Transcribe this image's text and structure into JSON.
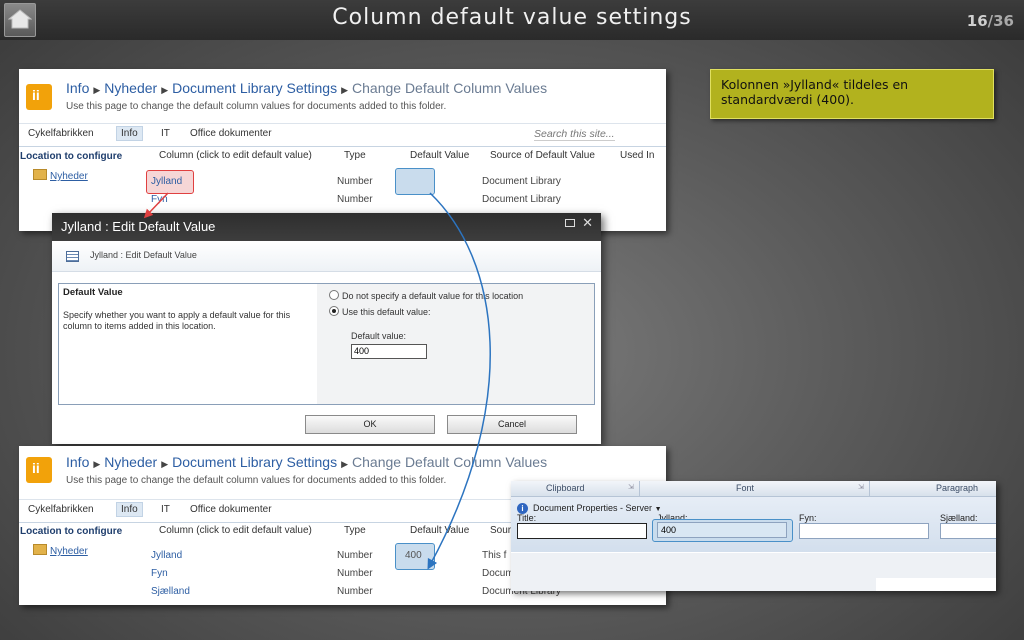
{
  "slide": {
    "title": "Column default value settings",
    "page": "16",
    "total": "/36",
    "home_icon": "home-icon"
  },
  "top_panel": {
    "breadcrumb": [
      "Info",
      "Nyheder",
      "Document Library Settings"
    ],
    "breadcrumb_last": "Change Default Column Values",
    "subtitle": "Use this page to change the default column values for documents added to this folder.",
    "nav": [
      "Cykelfabrikken",
      "Info",
      "IT",
      "Office dokumenter"
    ],
    "search_placeholder": "Search this site...",
    "headers": {
      "location": "Location to configure",
      "column": "Column (click to edit default value)",
      "type": "Type",
      "default": "Default Value",
      "source": "Source of Default Value",
      "used_in": "Used In"
    },
    "folder": "Nyheder",
    "rows": [
      {
        "column": "Jylland",
        "type": "Number",
        "default": "",
        "source": "Document Library"
      },
      {
        "column": "Fyn",
        "type": "Number",
        "default": "",
        "source": "Document Library"
      }
    ]
  },
  "dialog": {
    "title": "Jylland : Edit Default Value",
    "subtitle": "Jylland : Edit Default Value",
    "section_label": "Default Value",
    "description": "Specify whether you want to apply a default value for this column to items added in this location.",
    "option_none": "Do not specify a default value for this location",
    "option_use": "Use this default value:",
    "selected": "use",
    "value_label": "Default value:",
    "value": "400",
    "ok": "OK",
    "cancel": "Cancel"
  },
  "callout": {
    "text": "Kolonnen »Jylland« tildeles en standardværdi (400)."
  },
  "bottom_panel": {
    "breadcrumb": [
      "Info",
      "Nyheder",
      "Document Library Settings"
    ],
    "breadcrumb_last": "Change Default Column Values",
    "subtitle": "Use this page to change the default column values for documents added to this folder.",
    "nav": [
      "Cykelfabrikken",
      "Info",
      "IT",
      "Office dokumenter"
    ],
    "headers": {
      "location": "Location to configure",
      "column": "Column (click to edit default value)",
      "type": "Type",
      "default": "Default Value",
      "source": "Sour"
    },
    "folder": "Nyheder",
    "rows": [
      {
        "column": "Jylland",
        "type": "Number",
        "default": "400",
        "source": "This f"
      },
      {
        "column": "Fyn",
        "type": "Number",
        "default": "",
        "source": "Docum"
      },
      {
        "column": "Sjælland",
        "type": "Number",
        "default": "",
        "source": "Document Library"
      }
    ]
  },
  "ribbon": {
    "groups": [
      "Clipboard",
      "Font",
      "Paragraph"
    ],
    "docprops": "Document Properties - Server",
    "fields": [
      {
        "label": "Title:",
        "value": ""
      },
      {
        "label": "Jylland:",
        "value": "400"
      },
      {
        "label": "Fyn:",
        "value": ""
      },
      {
        "label": "Sjælland:",
        "value": ""
      }
    ]
  },
  "colors": {
    "callout_bg": "#b2b21e",
    "highlight_red": "#e04040",
    "highlight_blue": "#4a90c8",
    "arrow_blue": "#2c74c0",
    "logo_orange": "#f2a20a"
  }
}
